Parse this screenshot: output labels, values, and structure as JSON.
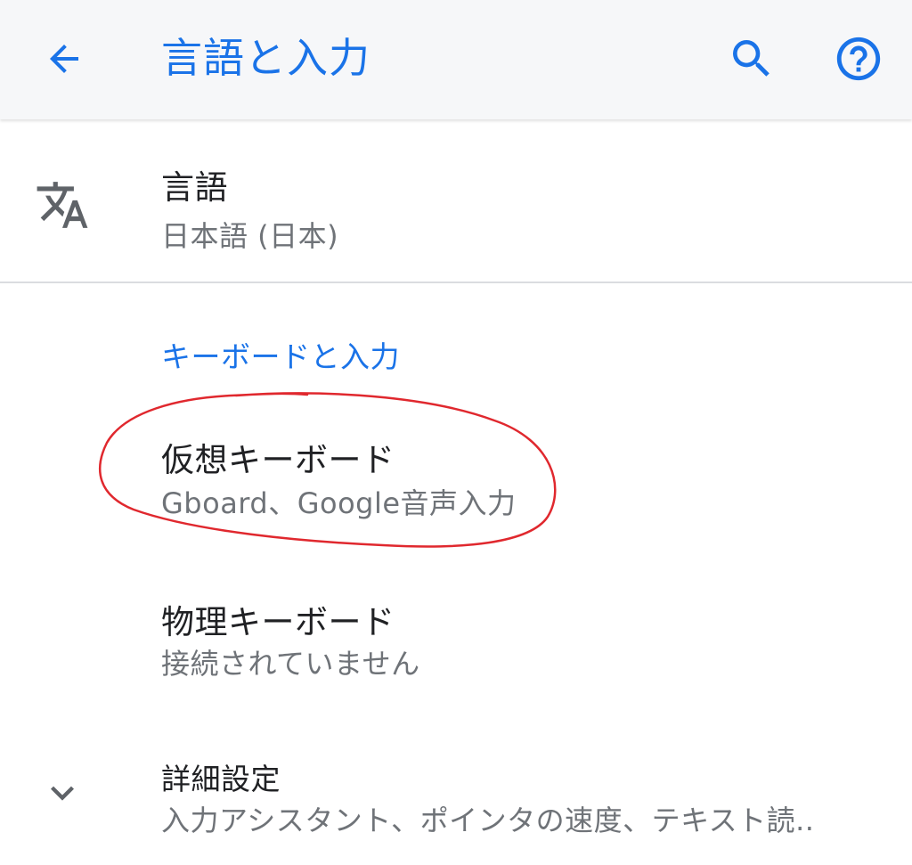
{
  "appbar": {
    "title": "言語と入力",
    "back_icon": "arrow-back-icon",
    "search_icon": "search-icon",
    "help_icon": "help-circle-icon",
    "accent_color": "#1a73e8"
  },
  "language": {
    "icon": "translate-icon",
    "title": "言語",
    "summary": "日本語 (日本)"
  },
  "keyboard_section": {
    "header": "キーボードと入力",
    "virtual_keyboard": {
      "title": "仮想キーボード",
      "summary": "Gboard、Google音声入力"
    },
    "physical_keyboard": {
      "title": "物理キーボード",
      "summary": "接続されていません"
    }
  },
  "advanced": {
    "icon": "chevron-down-icon",
    "title": "詳細設定",
    "summary": "入力アシスタント、ポインタの速度、テキスト読.."
  },
  "annotation_color": "#e0282e"
}
